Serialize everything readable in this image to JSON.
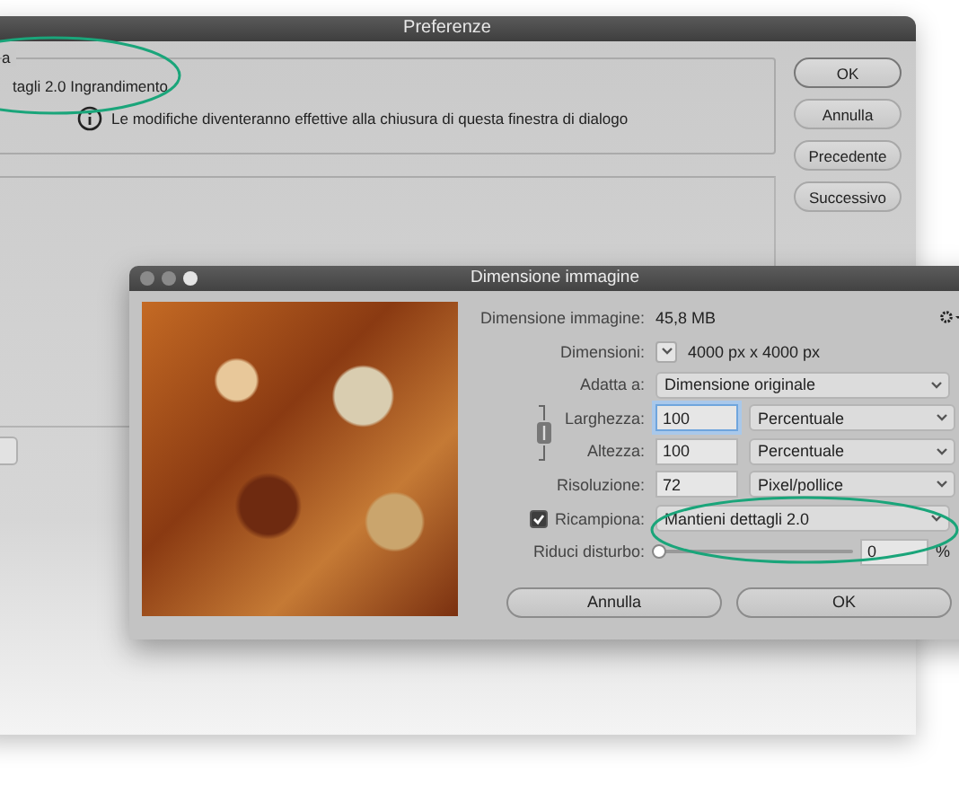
{
  "back_window": {
    "title": "Preferenze",
    "group_label": "a",
    "option": "tagli 2.0 Ingrandimento",
    "notice": "Le modifiche diventeranno effettive alla chiusura di questa finestra di dialogo",
    "buttons": [
      "OK",
      "Annulla",
      "Precedente",
      "Successivo"
    ]
  },
  "dialog": {
    "title": "Dimensione immagine",
    "size_label": "Dimensione immagine:",
    "size_value": "45,8 MB",
    "fields": [
      {
        "kind": "menu_text",
        "label": "Dimensioni:",
        "value": "4000 px x 4000 px"
      },
      {
        "kind": "select",
        "label": "Adatta a:",
        "value": "Dimensione originale"
      },
      {
        "kind": "input_select",
        "label": "Larghezza:",
        "value": "100",
        "unit": "Percentuale",
        "focused": true
      },
      {
        "kind": "input_select",
        "label": "Altezza:",
        "value": "100",
        "unit": "Percentuale",
        "focused": false
      },
      {
        "kind": "input_select",
        "label": "Risoluzione:",
        "value": "72",
        "unit": "Pixel/pollice",
        "focused": false
      },
      {
        "kind": "checkbox_select",
        "label": "Ricampiona:",
        "checked": true,
        "value": "Mantieni dettagli 2.0"
      },
      {
        "kind": "slider",
        "label": "Riduci disturbo:",
        "level": 0,
        "value": "0",
        "unit": "%"
      }
    ],
    "buttons": [
      "Annulla",
      "OK"
    ]
  }
}
